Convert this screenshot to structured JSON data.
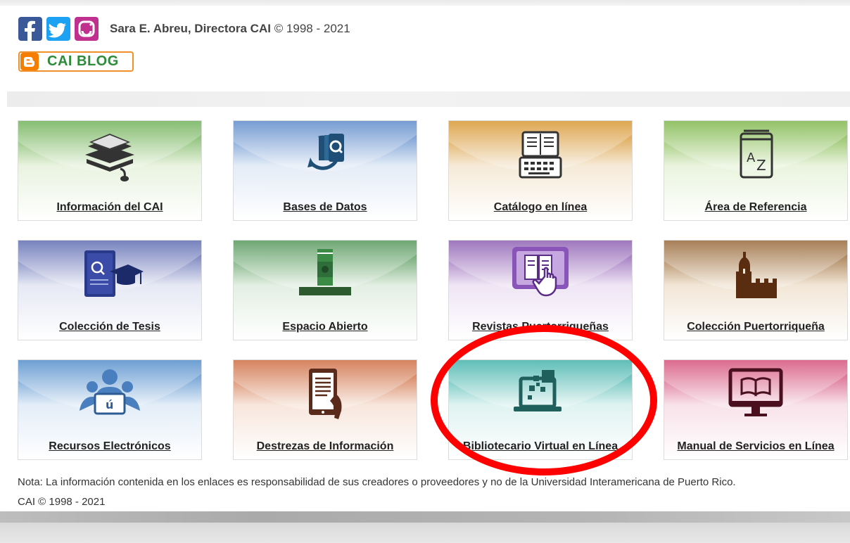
{
  "header": {
    "social_icons": [
      "facebook-icon",
      "twitter-icon",
      "instagram-icon"
    ],
    "credit_name": "Sara E. Abreu, Directora CAI",
    "credit_year": "© 1998 - 2021",
    "blog_label": "CAI BLOG"
  },
  "cards": [
    {
      "label": "Información del CAI",
      "theme": "#5fa844",
      "icon": "books-icon"
    },
    {
      "label": "Bases de Datos",
      "theme": "#4a7cc4",
      "icon": "database-search-icon"
    },
    {
      "label": "Catálogo en línea",
      "theme": "#d48a1a",
      "icon": "catalog-icon"
    },
    {
      "label": "Área de Referencia",
      "theme": "#6fae35",
      "icon": "dictionary-icon"
    },
    {
      "label": "Colección de Tesis",
      "theme": "#4b59a8",
      "icon": "thesis-icon"
    },
    {
      "label": "Espacio Abierto",
      "theme": "#3f8a45",
      "icon": "open-space-icon"
    },
    {
      "label": "Revistas Puertorriqueñas",
      "theme": "#7f4aa8",
      "icon": "magazine-touch-icon"
    },
    {
      "label": "Colección Puertorriqueña",
      "theme": "#8a5520",
      "icon": "castle-icon"
    },
    {
      "label": "Recursos Electrónicos",
      "theme": "#3d7fc4",
      "icon": "laptop-people-icon"
    },
    {
      "label": "Destrezas de Información",
      "theme": "#c95a2a",
      "icon": "tablet-hand-icon"
    },
    {
      "label": "Bibliotecario Virtual en Línea",
      "theme": "#2ba8a0",
      "icon": "virtual-librarian-icon"
    },
    {
      "label": "Manual de Servicios en Línea",
      "theme": "#d03a6a",
      "icon": "monitor-book-icon"
    }
  ],
  "footer": {
    "note": "Nota: La información contenida en los enlaces es responsabilidad de sus creadores o proveedores y no de la Universidad Interamericana de Puerto Rico.",
    "copyright": "CAI © 1998 - 2021"
  },
  "colors": {
    "highlight_circle": "#ff0000",
    "blog_orange": "#f57d00",
    "blog_green": "#2e8b3a"
  }
}
